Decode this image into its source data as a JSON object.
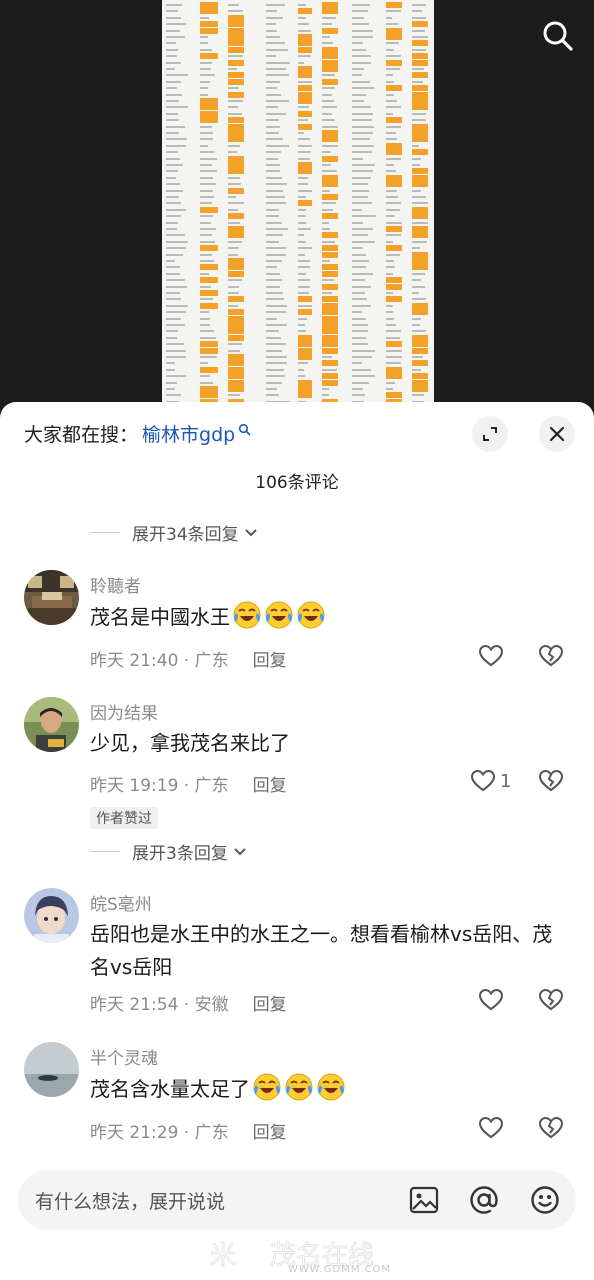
{
  "media": {
    "description_icon": "search-icon"
  },
  "panel": {
    "hot_search_prefix": "大家都在搜：",
    "hot_search_term": "榆林市gdp",
    "comment_count": "106条评论",
    "expand_icon": "expand-icon",
    "close_icon": "close-icon"
  },
  "replies_top": {
    "label": "展开34条回复"
  },
  "comments": [
    {
      "name": "聆聽者",
      "text": "茂名是中國水王",
      "emoji_count": 3,
      "time": "昨天 21:40 · 广东",
      "reply": "回复",
      "likes": ""
    },
    {
      "name": "因为结果",
      "text": "少见，拿我茂名来比了",
      "emoji_count": 0,
      "time": "昨天 19:19 · 广东",
      "reply": "回复",
      "likes": "1",
      "author_tag": "作者赞过",
      "expander": "展开3条回复"
    },
    {
      "name": "皖S亳州",
      "text": "岳阳也是水王中的水王之一。想看看榆林vs岳阳、茂名vs岳阳",
      "emoji_count": 0,
      "time": "昨天 21:54 · 安徽",
      "reply": "回复",
      "likes": ""
    },
    {
      "name": "半个灵魂",
      "text": "茂名含水量太足了",
      "emoji_count": 3,
      "time": "昨天 21:29 · 广东",
      "reply": "回复",
      "likes": ""
    }
  ],
  "input": {
    "placeholder": "有什么想法，展开说说",
    "icons": [
      "image-icon",
      "at-icon",
      "emoji-icon"
    ]
  },
  "watermark": {
    "text": "WWW.GDMM.COM"
  },
  "colors": {
    "link": "#1a57b8",
    "sheet_highlight": "#f39c1d",
    "emoji_yellow": "#ffcc33",
    "emoji_tear": "#3aa0ff"
  }
}
